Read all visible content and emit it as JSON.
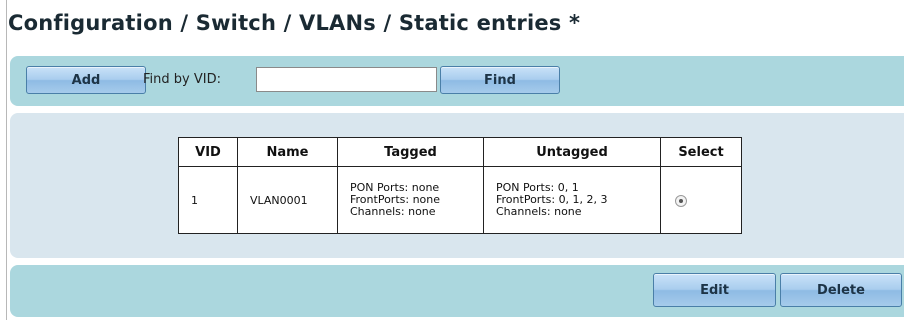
{
  "page": {
    "title": "Configuration / Switch / VLANs / Static entries *"
  },
  "toolbar": {
    "add_label": "Add",
    "find_label": "Find by VID:",
    "find_value": "",
    "find_button_label": "Find"
  },
  "table": {
    "headers": {
      "vid": "VID",
      "name": "Name",
      "tagged": "Tagged",
      "untagged": "Untagged",
      "select": "Select"
    },
    "rows": [
      {
        "vid": "1",
        "name": "VLAN0001",
        "tagged": {
          "pon": "PON Ports: none",
          "front": "FrontPorts: none",
          "channels": "Channels: none"
        },
        "untagged": {
          "pon": "PON Ports: 0, 1",
          "front": "FrontPorts: 0, 1, 2, 3",
          "channels": "Channels: none"
        },
        "selected": true
      }
    ]
  },
  "actions": {
    "edit_label": "Edit",
    "delete_label": "Delete"
  },
  "colors": {
    "bar": "#abd7de",
    "panel": "#d9e6ee",
    "button": "#a9cdee"
  }
}
